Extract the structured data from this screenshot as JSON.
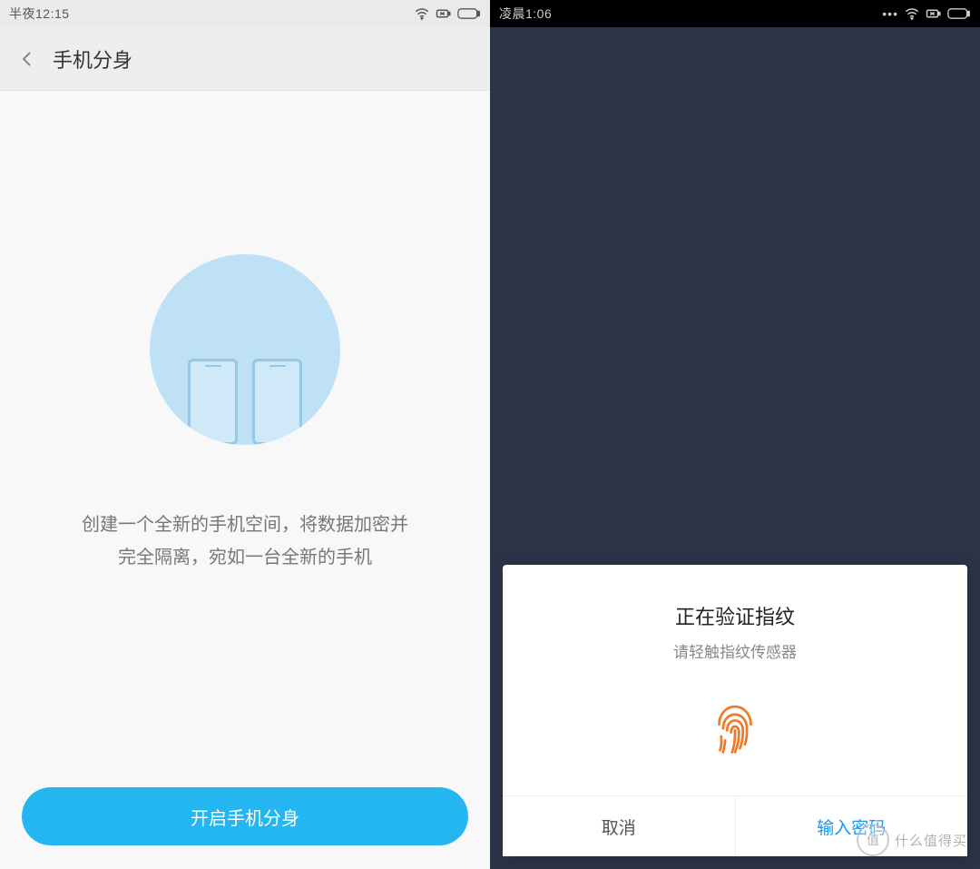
{
  "left": {
    "status_time": "半夜12:15",
    "title": "手机分身",
    "description_line1": "创建一个全新的手机空间，将数据加密并",
    "description_line2": "完全隔离，宛如一台全新的手机",
    "primary_button": "开启手机分身"
  },
  "right": {
    "status_time": "凌晨1:06",
    "dialog_title": "正在验证指纹",
    "dialog_subtitle": "请轻触指纹传感器",
    "cancel_button": "取消",
    "password_button": "输入密码"
  },
  "watermark": {
    "badge": "值",
    "text": "什么值得买"
  }
}
